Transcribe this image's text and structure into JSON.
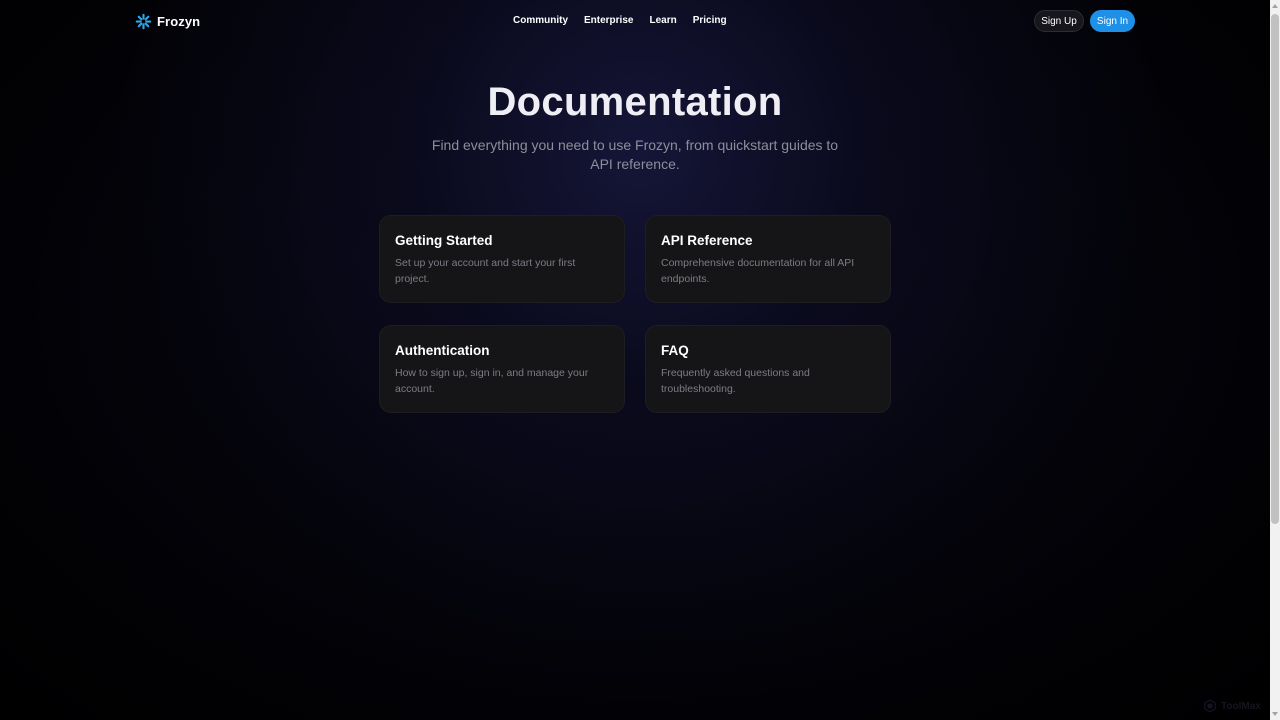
{
  "nav": {
    "brand": "Frozyn",
    "links": [
      "Community",
      "Enterprise",
      "Learn",
      "Pricing"
    ],
    "signup_label": "Sign Up",
    "signin_label": "Sign In"
  },
  "hero": {
    "title": "Documentation",
    "subtitle": "Find everything you need to use Frozyn, from quickstart guides to API reference."
  },
  "cards": [
    {
      "title": "Getting Started",
      "desc": "Set up your account and start your first project."
    },
    {
      "title": "API Reference",
      "desc": "Comprehensive documentation for all API endpoints."
    },
    {
      "title": "Authentication",
      "desc": "How to sign up, sign in, and manage your account."
    },
    {
      "title": "FAQ",
      "desc": "Frequently asked questions and troubleshooting."
    }
  ],
  "watermark": "ToolMax",
  "colors": {
    "accent": "#1e90e8",
    "brand_icon": "#2aa8f0",
    "card_bg": "#151518",
    "muted_text": "#7c7c86"
  },
  "icons": {
    "brand": "snowflake-icon",
    "watermark": "hexagon-logo-icon"
  }
}
